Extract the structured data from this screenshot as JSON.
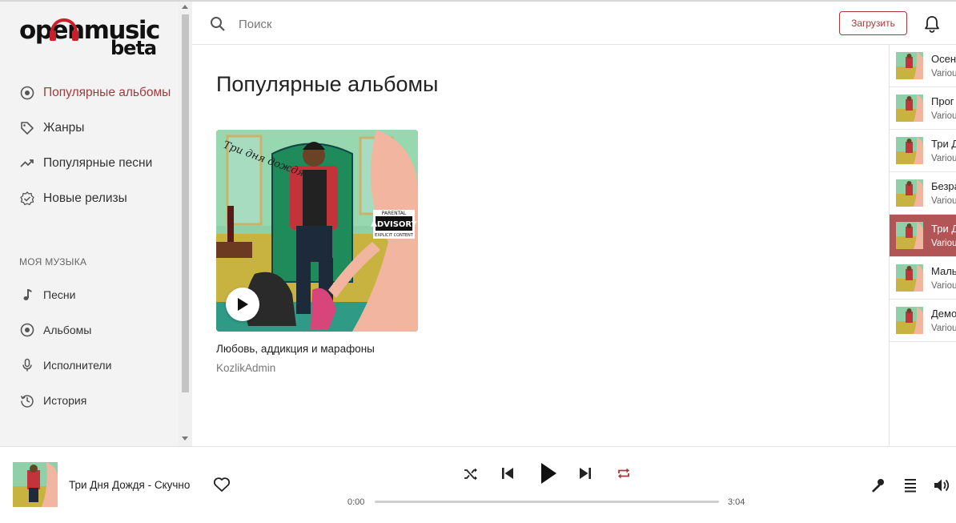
{
  "brand": {
    "logo_main": "openmusic",
    "logo_sub": "beta"
  },
  "sidebar": {
    "nav": [
      {
        "label": "Популярные альбомы",
        "icon": "disc-icon",
        "active": true
      },
      {
        "label": "Жанры",
        "icon": "tag-icon",
        "active": false
      },
      {
        "label": "Популярные песни",
        "icon": "trending-icon",
        "active": false
      },
      {
        "label": "Новые релизы",
        "icon": "verified-icon",
        "active": false
      }
    ],
    "section_label": "МОЯ МУЗЫКА",
    "my_music": [
      {
        "label": "Песни",
        "icon": "music-note-icon"
      },
      {
        "label": "Альбомы",
        "icon": "disc-icon"
      },
      {
        "label": "Исполнители",
        "icon": "microphone-icon"
      },
      {
        "label": "История",
        "icon": "history-icon"
      }
    ]
  },
  "header": {
    "search_placeholder": "Поиск",
    "upload_label": "Загрузить"
  },
  "main": {
    "title": "Популярные альбомы",
    "albums": [
      {
        "title": "Любовь, аддикция и марафоны",
        "artist": "KozlikAdmin",
        "cover_text": "Три дня дождя"
      }
    ]
  },
  "queue": [
    {
      "title": "Осен",
      "artist": "Variou",
      "active": false
    },
    {
      "title": "Прог",
      "artist": "Variou",
      "active": false
    },
    {
      "title": "Три Д",
      "artist": "Variou",
      "active": false
    },
    {
      "title": "Безра",
      "artist": "Variou",
      "active": false
    },
    {
      "title": "Три Д",
      "artist": "Variou",
      "active": true
    },
    {
      "title": "Мальч",
      "artist": "Variou",
      "active": false
    },
    {
      "title": "Демо",
      "artist": "Variou",
      "active": false
    }
  ],
  "player": {
    "now_playing": "Три Дня Дождя - Скучно",
    "time_current": "0:00",
    "time_total": "3:04",
    "progress_percent": 0
  },
  "colors": {
    "accent": "#a6393b",
    "active_row": "#b25556",
    "sidebar_bg": "#f3f3f3"
  }
}
